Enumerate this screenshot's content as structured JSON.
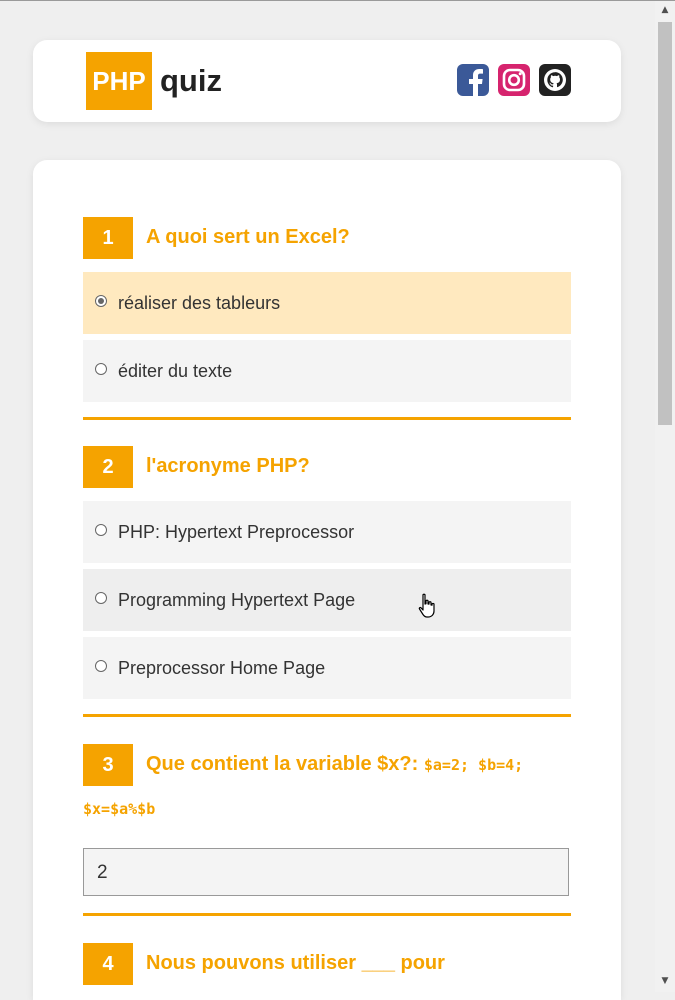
{
  "header": {
    "logo_badge": "PHP",
    "logo_word": "quiz",
    "social_icons": [
      "facebook-icon",
      "instagram-icon",
      "github-icon"
    ],
    "colors": {
      "accent": "#f5a300",
      "facebook": "#3b5998",
      "instagram": "#d6246e",
      "github": "#222222"
    }
  },
  "quiz": {
    "questions": [
      {
        "number": "1",
        "title": "A quoi sert un Excel?",
        "options": [
          {
            "label": "réaliser des tableurs",
            "checked": true
          },
          {
            "label": "éditer du texte",
            "checked": false
          }
        ]
      },
      {
        "number": "2",
        "title": "l'acronyme PHP?",
        "options": [
          {
            "label": "PHP: Hypertext Preprocessor",
            "checked": false
          },
          {
            "label": "Programming Hypertext Page",
            "checked": false
          },
          {
            "label": "Preprocessor Home Page",
            "checked": false
          }
        ]
      },
      {
        "number": "3",
        "title": "Que contient la variable $x?:",
        "code_line1": "$a=2; $b=4;",
        "code_line2": "$x=$a%$b",
        "answer_value": "2"
      },
      {
        "number": "4",
        "title": "Nous pouvons utiliser ___ pour"
      }
    ]
  }
}
